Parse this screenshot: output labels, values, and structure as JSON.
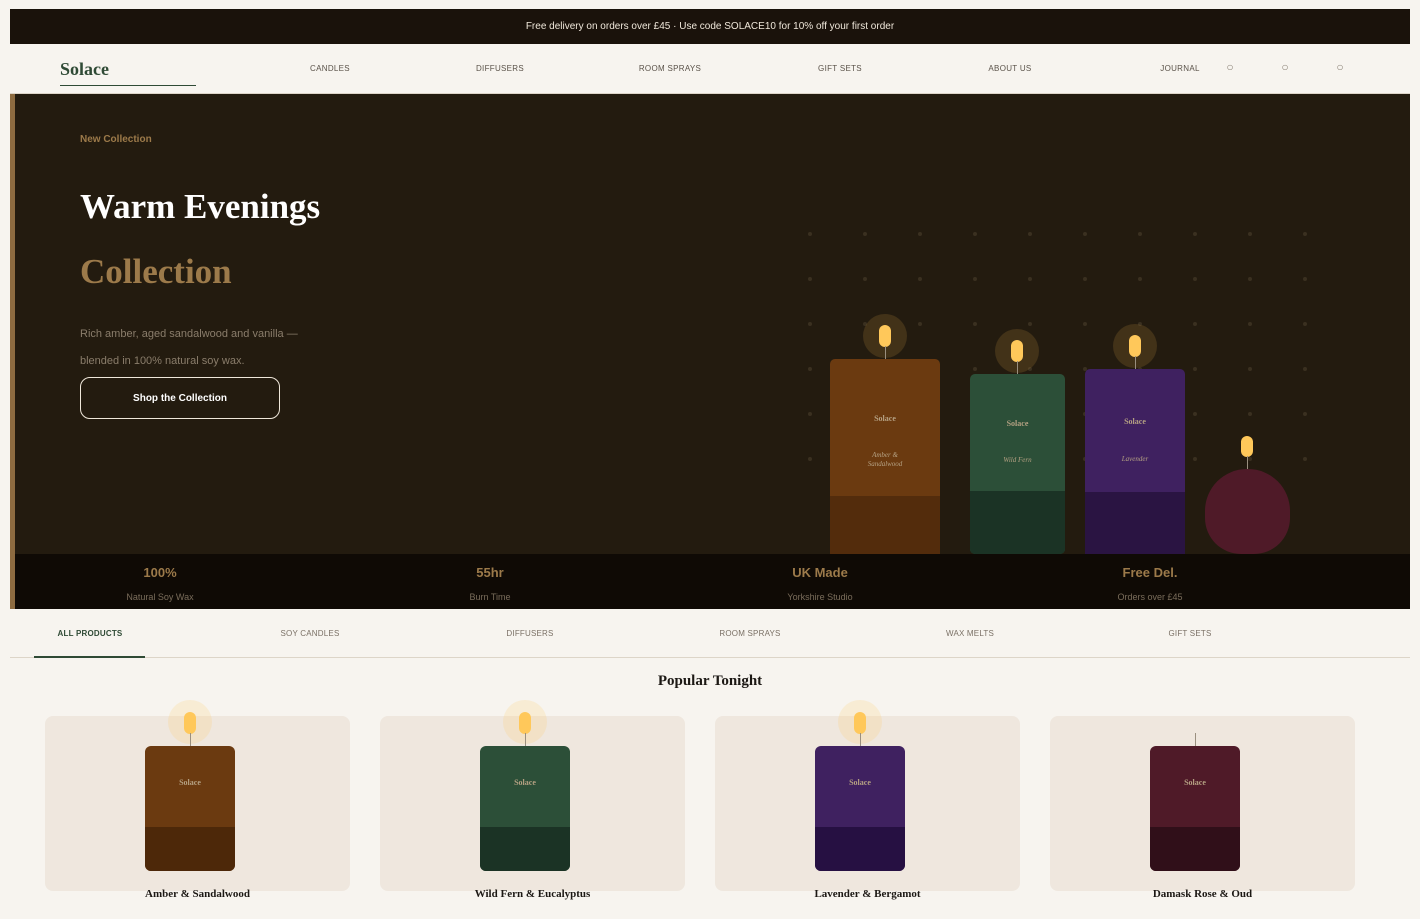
{
  "promo": {
    "text": "Free delivery on orders over £45  ·  Use code SOLACE10 for 10% off your first order"
  },
  "nav": {
    "logo": "Solace",
    "links": [
      "CANDLES",
      "DIFFUSERS",
      "ROOM SPRAYS",
      "GIFT SETS",
      "ABOUT US",
      "JOURNAL"
    ],
    "icons": [
      {
        "name": "search-icon",
        "glyph": "○"
      },
      {
        "name": "account-icon",
        "glyph": "○"
      },
      {
        "name": "bag-icon",
        "glyph": "○"
      }
    ]
  },
  "hero": {
    "eyebrow": "New Collection",
    "title_line1": "Warm Evenings",
    "title_line2": "Collection",
    "description_line1": "Rich amber, aged sandalwood and vanilla —",
    "description_line2": "blended in 100% natural soy wax.",
    "cta": "Shop the Collection",
    "candles": [
      {
        "brand": "Solace",
        "scent": "Amber & Sandalwood",
        "color": "#6b3a10",
        "base": "#532c0c",
        "lit": true
      },
      {
        "brand": "Solace",
        "scent": "Wild Fern",
        "color": "#2c4f38",
        "base": "#1b3325",
        "lit": true
      },
      {
        "brand": "Solace",
        "scent": "Lavender",
        "color": "#3f2160",
        "base": "#2a1442",
        "lit": true
      },
      {
        "brand": "",
        "scent": "",
        "color": "#4f1a28",
        "base": "#4f1a28",
        "lit": true
      }
    ]
  },
  "stats": [
    {
      "value": "100%",
      "label": "Natural Soy Wax"
    },
    {
      "value": "55hr",
      "label": "Burn Time"
    },
    {
      "value": "UK Made",
      "label": "Yorkshire Studio"
    },
    {
      "value": "Free Del.",
      "label": "Orders over £45"
    }
  ],
  "filters": {
    "tabs": [
      "ALL PRODUCTS",
      "SOY CANDLES",
      "DIFFUSERS",
      "ROOM SPRAYS",
      "WAX MELTS",
      "GIFT SETS"
    ],
    "active": "ALL PRODUCTS"
  },
  "section_title": "Popular Tonight",
  "products": [
    {
      "name": "Amber & Sandalwood",
      "brand": "Solace",
      "color": "#6b3a10",
      "base": "#4d2809",
      "lit": true
    },
    {
      "name": "Wild Fern & Eucalyptus",
      "brand": "Solace",
      "color": "#2c4f38",
      "base": "#1b3325",
      "lit": true
    },
    {
      "name": "Lavender & Bergamot",
      "brand": "Solace",
      "color": "#3f2160",
      "base": "#261042",
      "lit": true
    },
    {
      "name": "Damask Rose & Oud",
      "brand": "Solace",
      "color": "#4f1a28",
      "base": "#300f19",
      "lit": false
    }
  ]
}
